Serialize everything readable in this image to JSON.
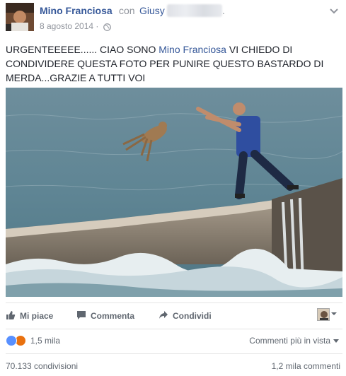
{
  "header": {
    "author": "Mino Franciosa",
    "with_label": "con",
    "tagged_name": "Giusy",
    "trailing": ".",
    "date": "8 agosto 2014 · ",
    "privacy_icon": "globe-icon",
    "menu_icon": "chevron-down-icon"
  },
  "post": {
    "text_before": "URGENTEEEEE...... CIAO SONO ",
    "text_name": "Mino Franciosa",
    "text_after": " VI CHIEDO DI CONDIVIDERE QUESTA FOTO PER PUNIRE QUESTO BASTARDO DI MERDA...GRAZIE A TUTTI VOI"
  },
  "actions": {
    "like": "Mi piace",
    "comment": "Commenta",
    "share": "Condividi"
  },
  "reactions": {
    "count": "1,5 mila",
    "types": [
      "like",
      "angry"
    ],
    "colors": {
      "like": "#5890ff",
      "angry": "#e9710f"
    }
  },
  "sort": {
    "label": "Commenti più in vista"
  },
  "stats": {
    "shares": "70.133 condivisioni",
    "comments": "1,2 mila commenti"
  },
  "colors": {
    "link": "#365899",
    "muted": "#90949c",
    "action": "#606770"
  }
}
